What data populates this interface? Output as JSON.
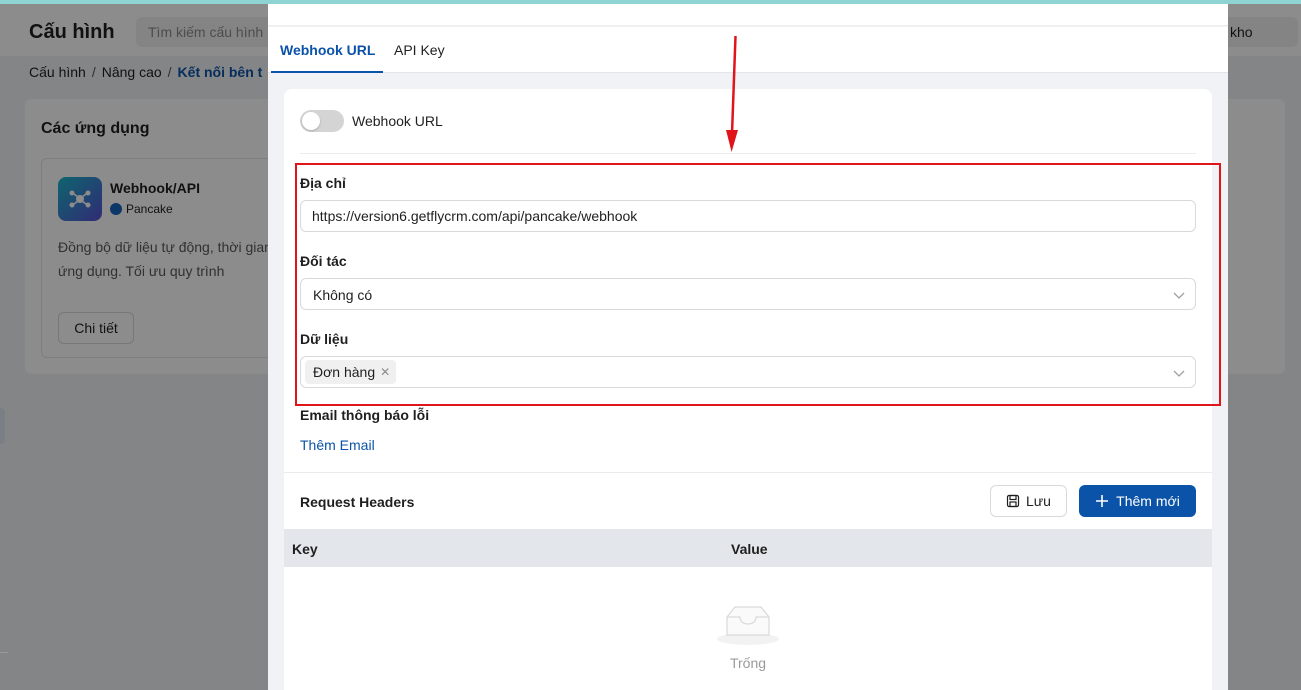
{
  "background": {
    "title": "Cấu hình",
    "search_placeholder": "Tìm kiếm cấu hình",
    "search_tail": "kho",
    "breadcrumb": [
      "Cấu hình",
      "Nâng cao",
      "Kết nối bên t"
    ],
    "card_title": "Các ứng dụng",
    "app": {
      "name": "Webhook/API",
      "vendor": "Pancake",
      "description": "Đồng bộ dữ liệu tự động, thời gian thống/ứng dụng. Tối ưu quy trình",
      "detail_button": "Chi tiết"
    }
  },
  "modal": {
    "tabs": [
      {
        "label": "Webhook URL",
        "active": true
      },
      {
        "label": "API Key",
        "active": false
      }
    ],
    "webhook_toggle": {
      "label": "Webhook URL",
      "enabled": false
    },
    "fields": {
      "address": {
        "label": "Địa chỉ",
        "value": "https://version6.getflycrm.com/api/pancake/webhook"
      },
      "partner": {
        "label": "Đối tác",
        "value": "Không có"
      },
      "data": {
        "label": "Dữ liệu",
        "tags": [
          "Đơn hàng"
        ]
      },
      "error_email": {
        "label": "Email thông báo lỗi",
        "add_link": "Thêm Email"
      }
    },
    "request_headers": {
      "title": "Request Headers",
      "save_label": "Lưu",
      "add_label": "Thêm mới",
      "columns": [
        "Key",
        "Value"
      ],
      "empty_text": "Trống"
    }
  },
  "colors": {
    "primary": "#0b53a8",
    "highlight_border": "#e0141b",
    "overlay": "rgba(0,0,0,0.45)"
  }
}
